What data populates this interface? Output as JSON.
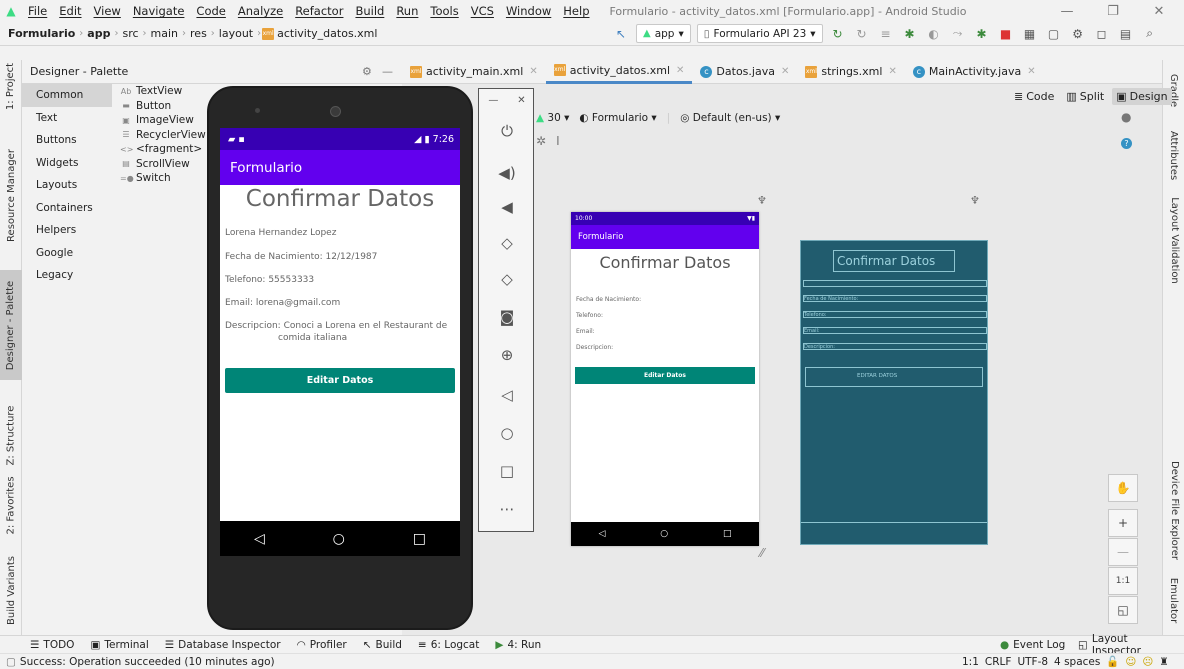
{
  "menubar": {
    "items": [
      "File",
      "Edit",
      "View",
      "Navigate",
      "Code",
      "Analyze",
      "Refactor",
      "Build",
      "Run",
      "Tools",
      "VCS",
      "Window",
      "Help"
    ],
    "window_title": "Formulario - activity_datos.xml [Formulario.app] - Android Studio"
  },
  "breadcrumb": [
    "Formulario",
    "app",
    "src",
    "main",
    "res",
    "layout",
    "activity_datos.xml"
  ],
  "toolbar": {
    "run_config": "app",
    "device": "Formulario API 23"
  },
  "left_strip": [
    "1: Project",
    "Resource Manager",
    "Designer - Palette",
    "Z: Structure",
    "2: Favorites",
    "Build Variants"
  ],
  "right_strip": [
    "Gradle",
    "Attributes",
    "Layout Validation",
    "Device File Explorer",
    "Emulator"
  ],
  "palette": {
    "title": "Designer - Palette",
    "categories": [
      "Common",
      "Text",
      "Buttons",
      "Widgets",
      "Layouts",
      "Containers",
      "Helpers",
      "Google",
      "Legacy"
    ],
    "selected_category": "Common",
    "items": [
      {
        "icon": "Ab",
        "label": "TextView"
      },
      {
        "icon": "▬",
        "label": "Button"
      },
      {
        "icon": "▣",
        "label": "ImageView"
      },
      {
        "icon": "☰",
        "label": "RecyclerView"
      },
      {
        "icon": "<>",
        "label": "<fragment>"
      },
      {
        "icon": "▤",
        "label": "ScrollView"
      },
      {
        "icon": "=●",
        "label": "Switch"
      }
    ]
  },
  "editor_tabs": [
    {
      "label": "activity_main.xml",
      "type": "xml",
      "active": false
    },
    {
      "label": "activity_datos.xml",
      "type": "xml",
      "active": true
    },
    {
      "label": "Datos.java",
      "type": "java",
      "active": false
    },
    {
      "label": "strings.xml",
      "type": "xml",
      "active": false
    },
    {
      "label": "MainActivity.java",
      "type": "java",
      "active": false
    }
  ],
  "view_modes": {
    "code": "Code",
    "split": "Split",
    "design": "Design"
  },
  "design_toolbar": {
    "api": "30",
    "theme": "Formulario",
    "locale": "Default (en-us)"
  },
  "emulator": {
    "time": "7:26",
    "app_title": "Formulario",
    "heading": "Confirmar Datos",
    "name": "Lorena Hernandez Lopez",
    "birth": "Fecha de Nacimiento: 12/12/1987",
    "phone": "Telefono: 55553333",
    "email": "Email: lorena@gmail.com",
    "desc_line1": "Descripcion: Conoci a Lorena en el Restaurant de",
    "desc_line2": "comida italiana",
    "button": "Editar Datos"
  },
  "preview": {
    "time": "10:00",
    "app_title": "Formulario",
    "heading": "Confirmar Datos",
    "birth": "Fecha de Nacimiento:",
    "phone": "Telefono:",
    "email": "Email:",
    "desc": "Descripcion:",
    "button": "Editar Datos"
  },
  "blueprint": {
    "heading": "Confirmar Datos",
    "birth": "Fecha de Nacimiento:",
    "phone": "Telefono:",
    "email": "Email:",
    "desc": "Descripcion:",
    "button": "EDITAR DATOS"
  },
  "zoom": {
    "ratio": "1:1"
  },
  "bottom_tools": [
    "TODO",
    "Terminal",
    "Database Inspector",
    "Profiler",
    "Build",
    "6: Logcat",
    "4: Run"
  ],
  "bottom_right_tools": [
    "Event Log",
    "Layout Inspector"
  ],
  "status": {
    "message": "Success: Operation succeeded (10 minutes ago)",
    "position": "1:1",
    "line_sep": "CRLF",
    "encoding": "UTF-8",
    "indent": "4 spaces"
  }
}
